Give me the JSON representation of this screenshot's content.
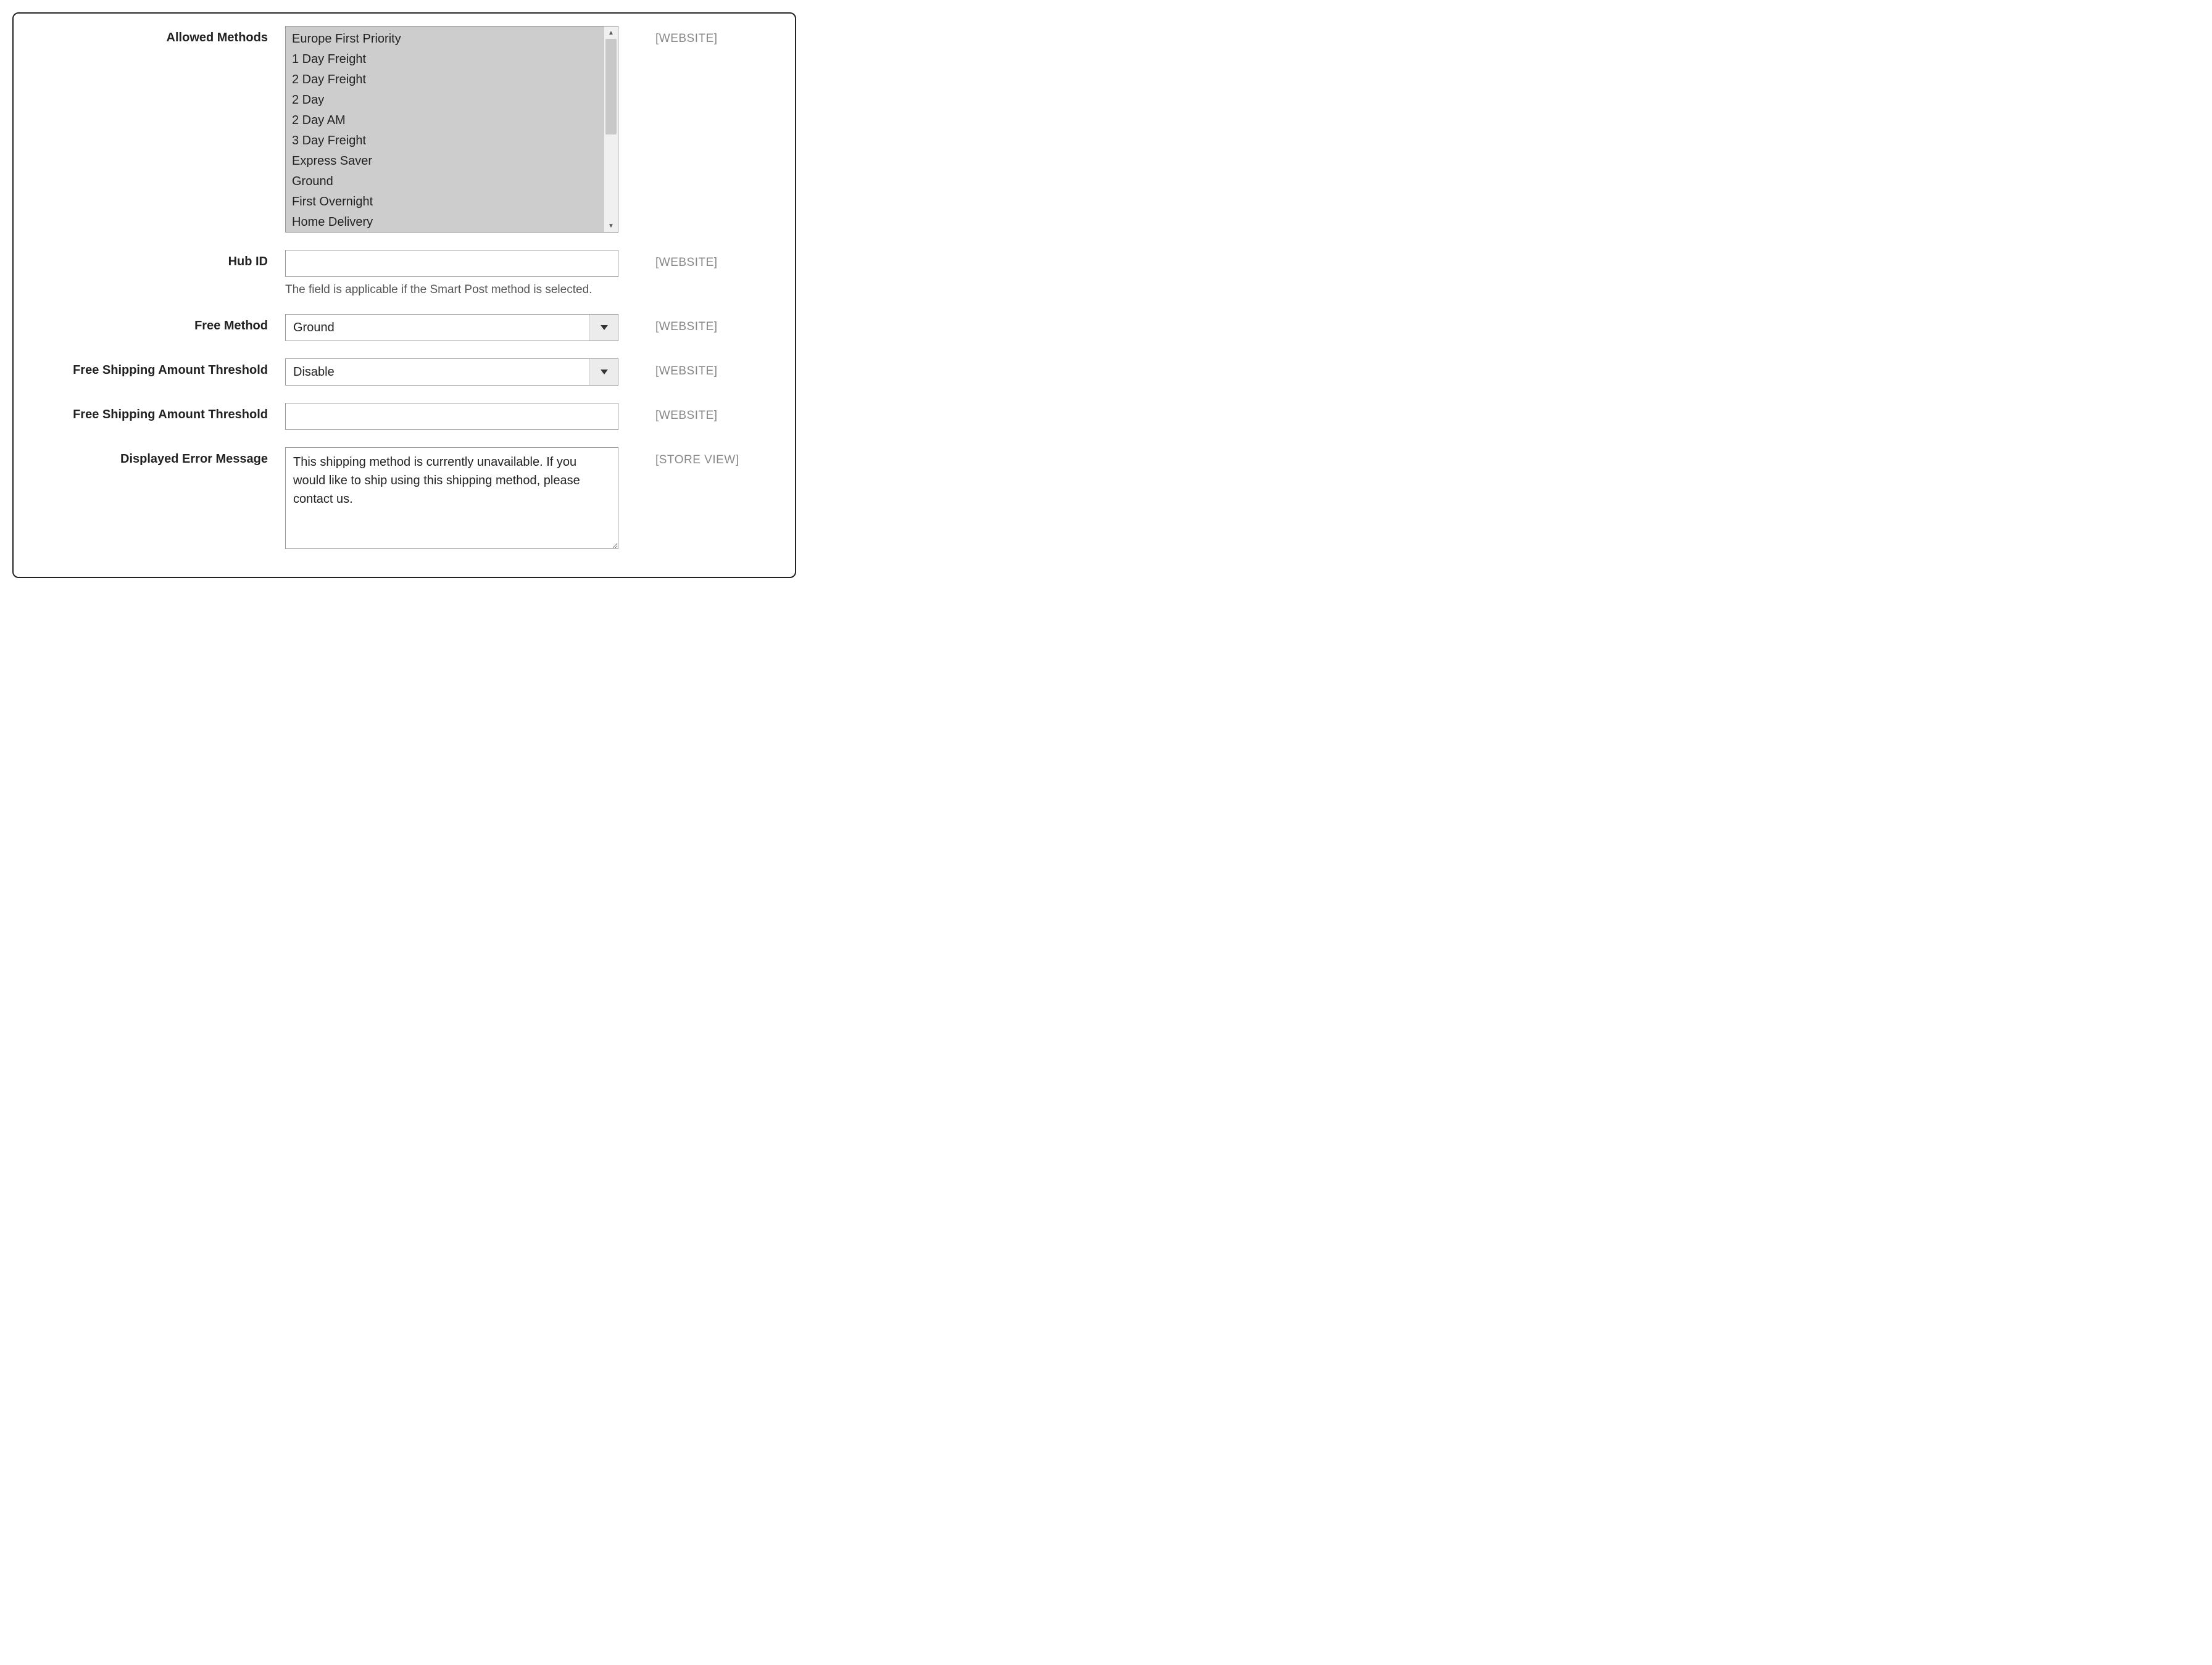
{
  "scope_website": "[WEBSITE]",
  "scope_storeview": "[STORE VIEW]",
  "fields": {
    "allowed_methods": {
      "label": "Allowed Methods",
      "options": [
        "Europe First Priority",
        "1 Day Freight",
        "2 Day Freight",
        "2 Day",
        "2 Day AM",
        "3 Day Freight",
        "Express Saver",
        "Ground",
        "First Overnight",
        "Home Delivery"
      ]
    },
    "hub_id": {
      "label": "Hub ID",
      "value": "",
      "help": "The field is applicable if the Smart Post method is selected."
    },
    "free_method": {
      "label": "Free Method",
      "value": "Ground"
    },
    "free_threshold_select": {
      "label": "Free Shipping Amount Threshold",
      "value": "Disable"
    },
    "free_threshold_input": {
      "label": "Free Shipping Amount Threshold",
      "value": ""
    },
    "error_message": {
      "label": "Displayed Error Message",
      "value": "This shipping method is currently unavailable. If you would like to ship using this shipping method, please contact us."
    }
  }
}
